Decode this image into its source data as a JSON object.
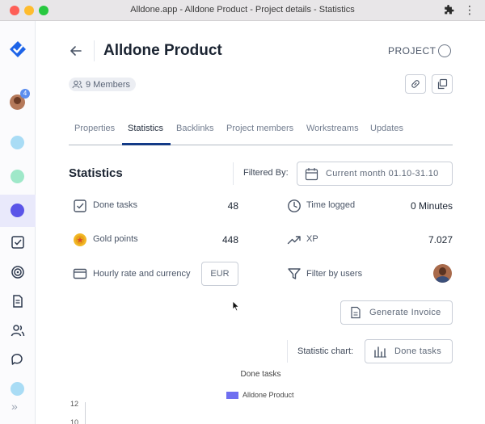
{
  "window": {
    "title": "Alldone.app - Alldone Product - Project details - Statistics"
  },
  "sidebar": {
    "badge_count": "4",
    "dots": [
      "#a9dcf5",
      "#9fe8c9",
      "#5b55e8",
      "#a9dcf5"
    ]
  },
  "header": {
    "title": "Alldone Product",
    "type_label": "PROJECT",
    "members_label": "9 Members"
  },
  "tabs": [
    {
      "label": "Properties"
    },
    {
      "label": "Statistics",
      "active": true
    },
    {
      "label": "Backlinks"
    },
    {
      "label": "Project members"
    },
    {
      "label": "Workstreams"
    },
    {
      "label": "Updates"
    }
  ],
  "stats": {
    "title": "Statistics",
    "filtered_label": "Filtered By:",
    "date_range": "Current month 01.10-31.10",
    "done_tasks": {
      "label": "Done tasks",
      "value": "48"
    },
    "time_logged": {
      "label": "Time logged",
      "value": "0 Minutes"
    },
    "gold_points": {
      "label": "Gold points",
      "value": "448"
    },
    "xp": {
      "label": "XP",
      "value": "7.027"
    },
    "hourly": {
      "label": "Hourly rate and currency",
      "currency": "EUR"
    },
    "filter_users": {
      "label": "Filter by users"
    },
    "invoice_button": "Generate Invoice",
    "chart_label": "Statistic chart:",
    "chart_button": "Done tasks"
  },
  "colors": {
    "accent": "#123a8a",
    "series": "#6f6ff0",
    "brand": "#1e64e8"
  },
  "chart_data": {
    "type": "bar",
    "title": "Done tasks",
    "series": [
      {
        "name": "Alldone Product",
        "values": []
      }
    ],
    "y_ticks": [
      "12",
      "10"
    ],
    "legend_position": "top"
  }
}
